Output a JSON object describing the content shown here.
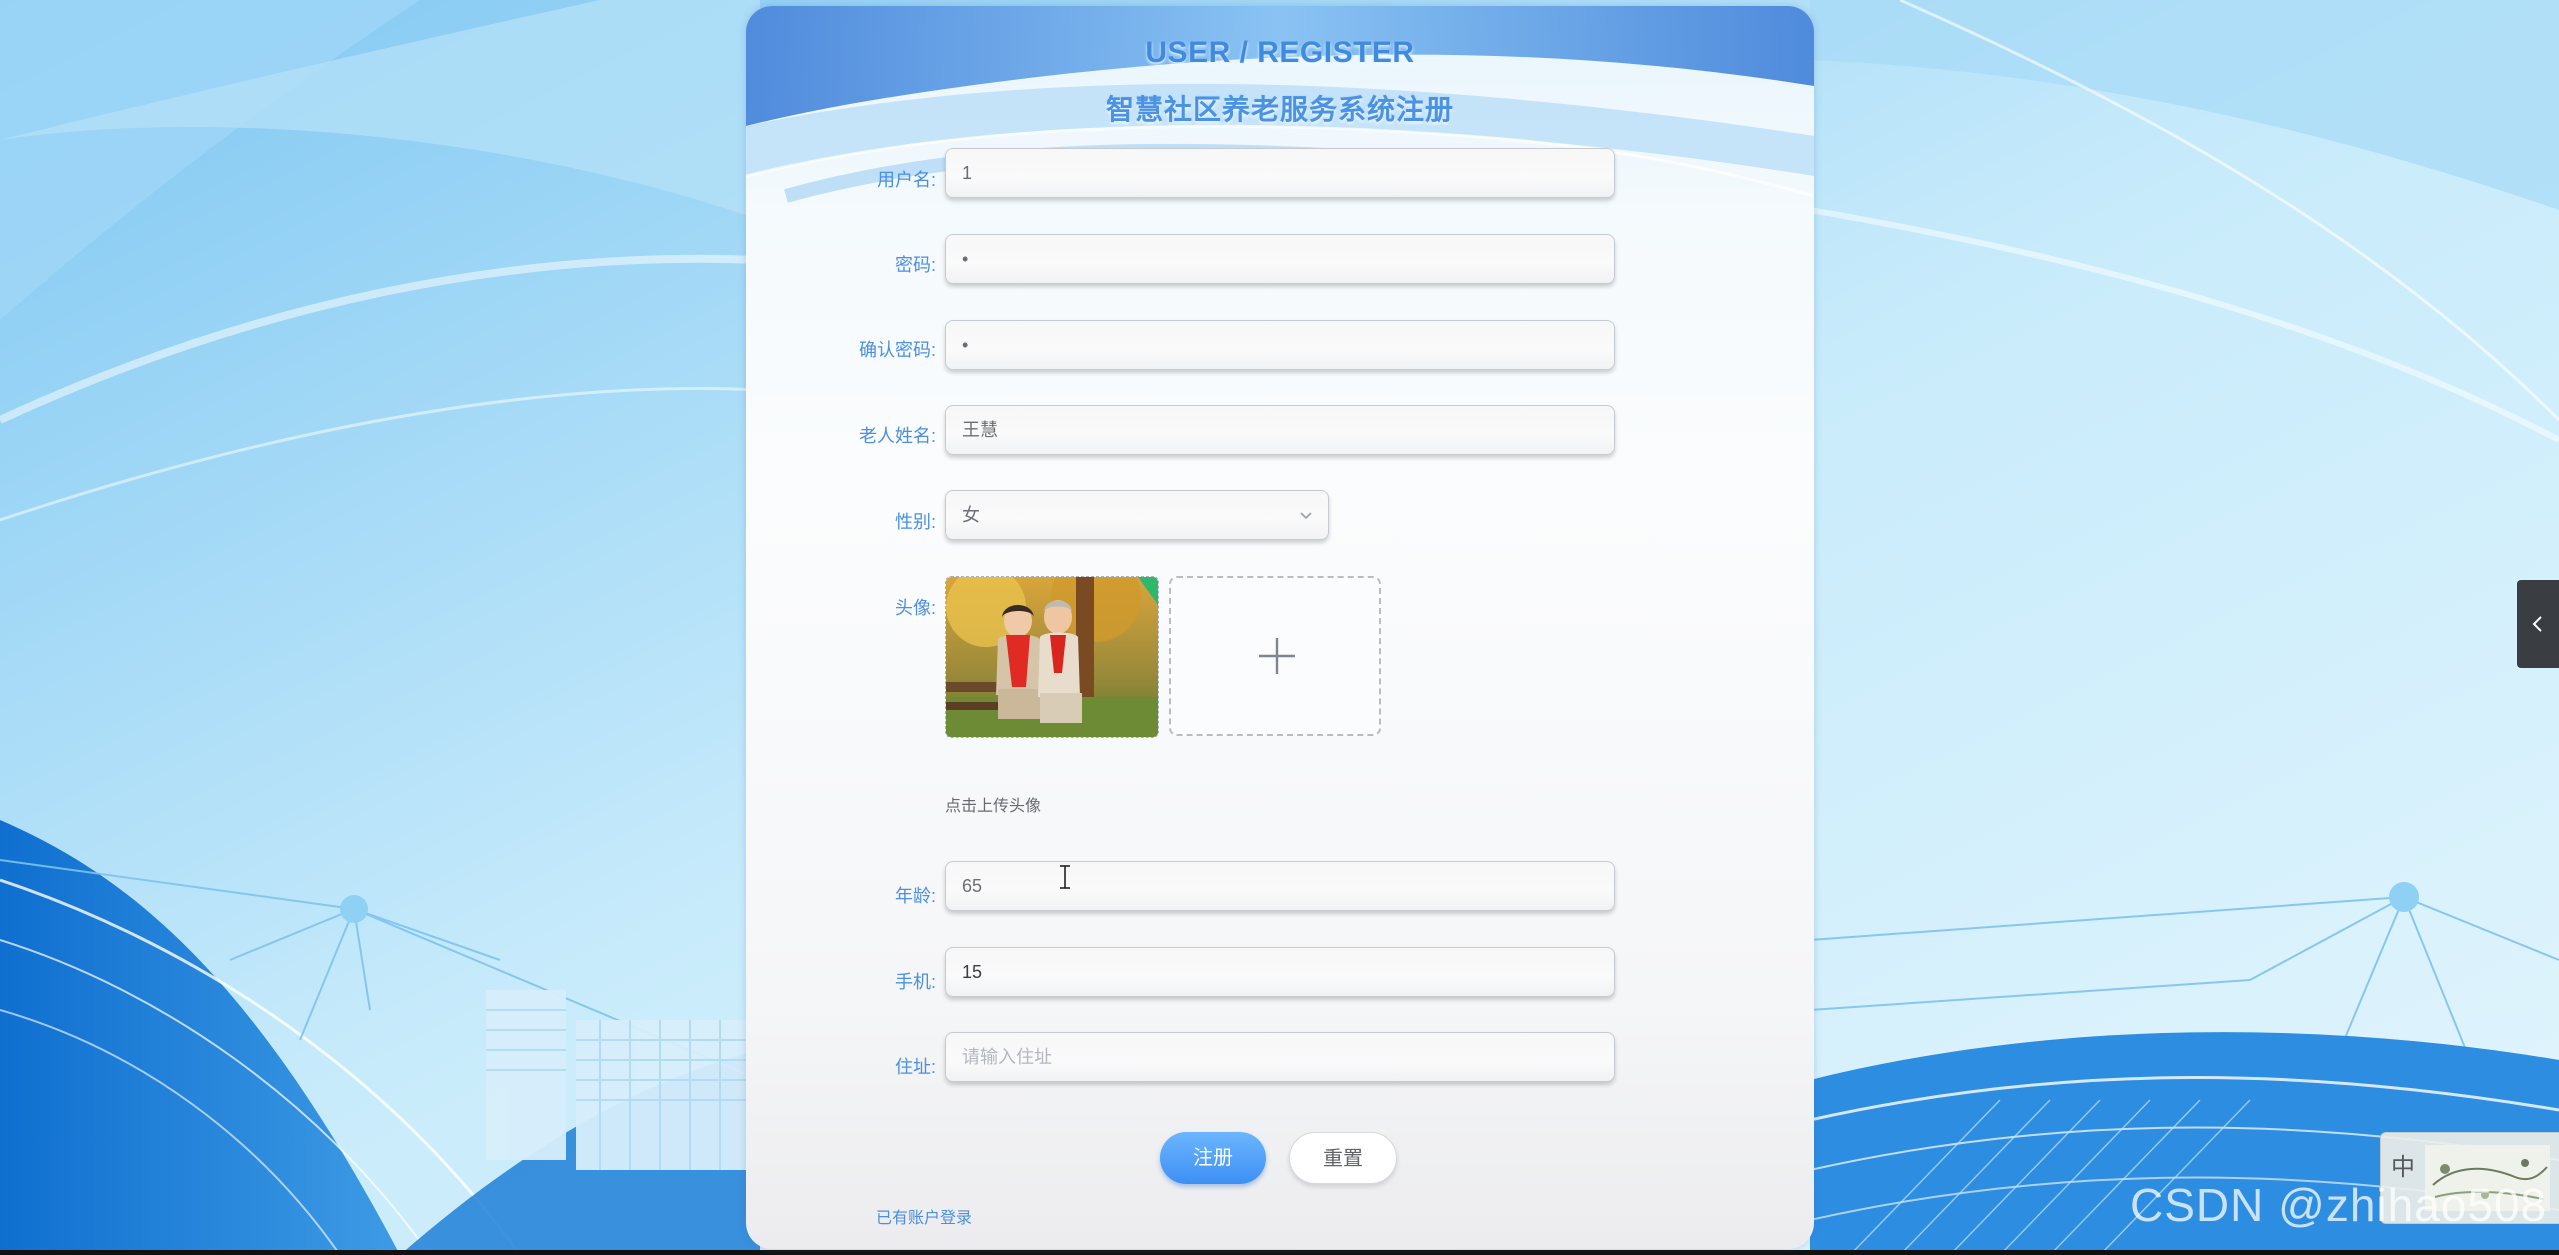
{
  "header": {
    "title_en": "USER / REGISTER",
    "title_cn": "智慧社区养老服务系统注册"
  },
  "form": {
    "username": {
      "label": "用户名:",
      "value": "1"
    },
    "password": {
      "label": "密码:",
      "value": "•"
    },
    "confirm_password": {
      "label": "确认密码:",
      "value": "•"
    },
    "elder_name": {
      "label": "老人姓名:",
      "value": "王慧"
    },
    "gender": {
      "label": "性别:",
      "value": "女"
    },
    "avatar": {
      "label": "头像:",
      "hint": "点击上传头像",
      "add_symbol": "+"
    },
    "age": {
      "label": "年龄:",
      "value": "65"
    },
    "phone": {
      "label": "手机:",
      "value": "15"
    },
    "address": {
      "label": "住址:",
      "placeholder": "请输入住址"
    }
  },
  "actions": {
    "register_label": "注册",
    "reset_label": "重置",
    "login_link": "已有账户登录"
  },
  "ime": {
    "mode_char": "中"
  },
  "watermark": "CSDN @zhihao508",
  "colors": {
    "accent": "#3d8ff4",
    "label": "#4a8fe0",
    "card_bg": "#fbfcfd"
  }
}
